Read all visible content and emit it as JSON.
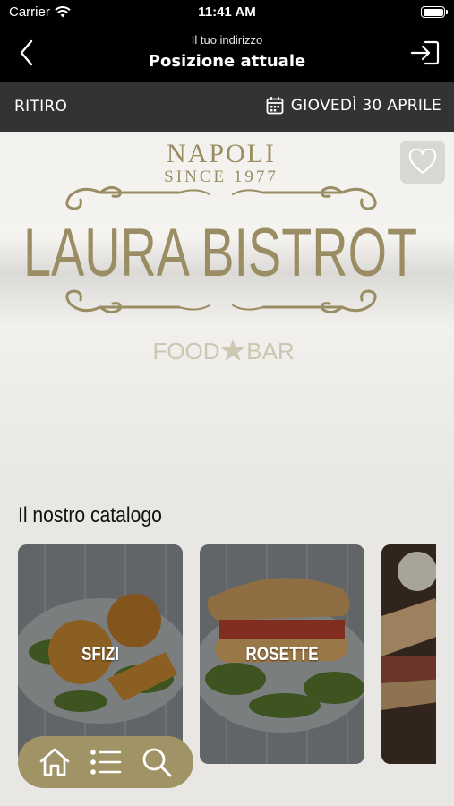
{
  "status_bar": {
    "carrier": "Carrier",
    "time": "11:41 AM"
  },
  "header": {
    "subtitle": "Il tuo indirizzo",
    "title": "Posizione attuale"
  },
  "subbar": {
    "mode": "RITIRO",
    "date": "GIOVEDÌ 30 APRILE"
  },
  "hero": {
    "logo": {
      "top_text": "NAPOLI",
      "since_text": "SINCE 1977",
      "name": "LAURA BISTROT",
      "tagline_left": "FOOD",
      "tagline_right": "BAR"
    }
  },
  "catalog": {
    "title": "Il nostro catalogo",
    "items": [
      {
        "label": "SFIZI"
      },
      {
        "label": "ROSETTE"
      },
      {
        "label": ""
      }
    ]
  },
  "colors": {
    "accent_gold": "#a09366",
    "logo_gold": "#9b8d63",
    "header_bg": "#000000",
    "subbar_bg": "#333333"
  }
}
